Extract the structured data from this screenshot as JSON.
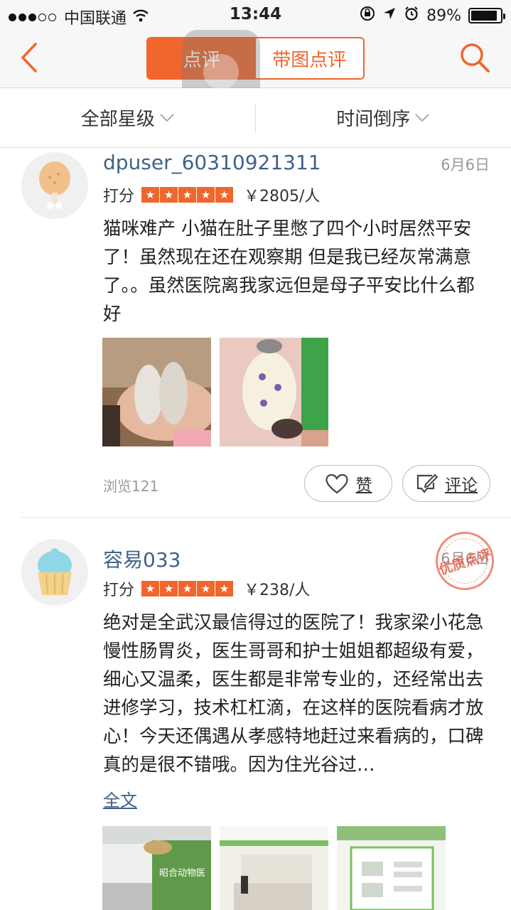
{
  "status_bar": {
    "carrier": "中国联通",
    "time": "13:44",
    "battery": "89%"
  },
  "nav": {
    "tab_active": "点评",
    "tab_inactive": "带图点评"
  },
  "filters": {
    "stars": "全部星级",
    "sort": "时间倒序"
  },
  "reviews": [
    {
      "username": "dpuser_60310921311",
      "date": "6月6日",
      "rating_label": "打分",
      "stars": 5,
      "price": "￥2805/人",
      "text": "猫咪难产 小猫在肚子里憋了四个小时居然平安了！虽然现在还在观察期 但是我已经灰常满意了。。虽然医院离我家远但是母子平安比什么都好",
      "views": "浏览121",
      "like_label": "赞",
      "comment_label": "评论"
    },
    {
      "username": "容易033",
      "date": "6月6日",
      "rating_label": "打分",
      "stars": 5,
      "price": "￥238/人",
      "text": "绝对是全武汉最信得过的医院了！我家梁小花急慢性肠胃炎，医生哥哥和护士姐姐都超级有爱，细心又温柔，医生都是非常专业的，还经常出去进修学习，技术杠杠滴，在这样的医院看病才放心！今天还偶遇从孝感特地赶过来看病的，口碑真的是很不错哦。因为住光谷过…",
      "fulltext": "全文",
      "stamp": "优质点评",
      "photo_sign": "昭合动物医"
    }
  ]
}
